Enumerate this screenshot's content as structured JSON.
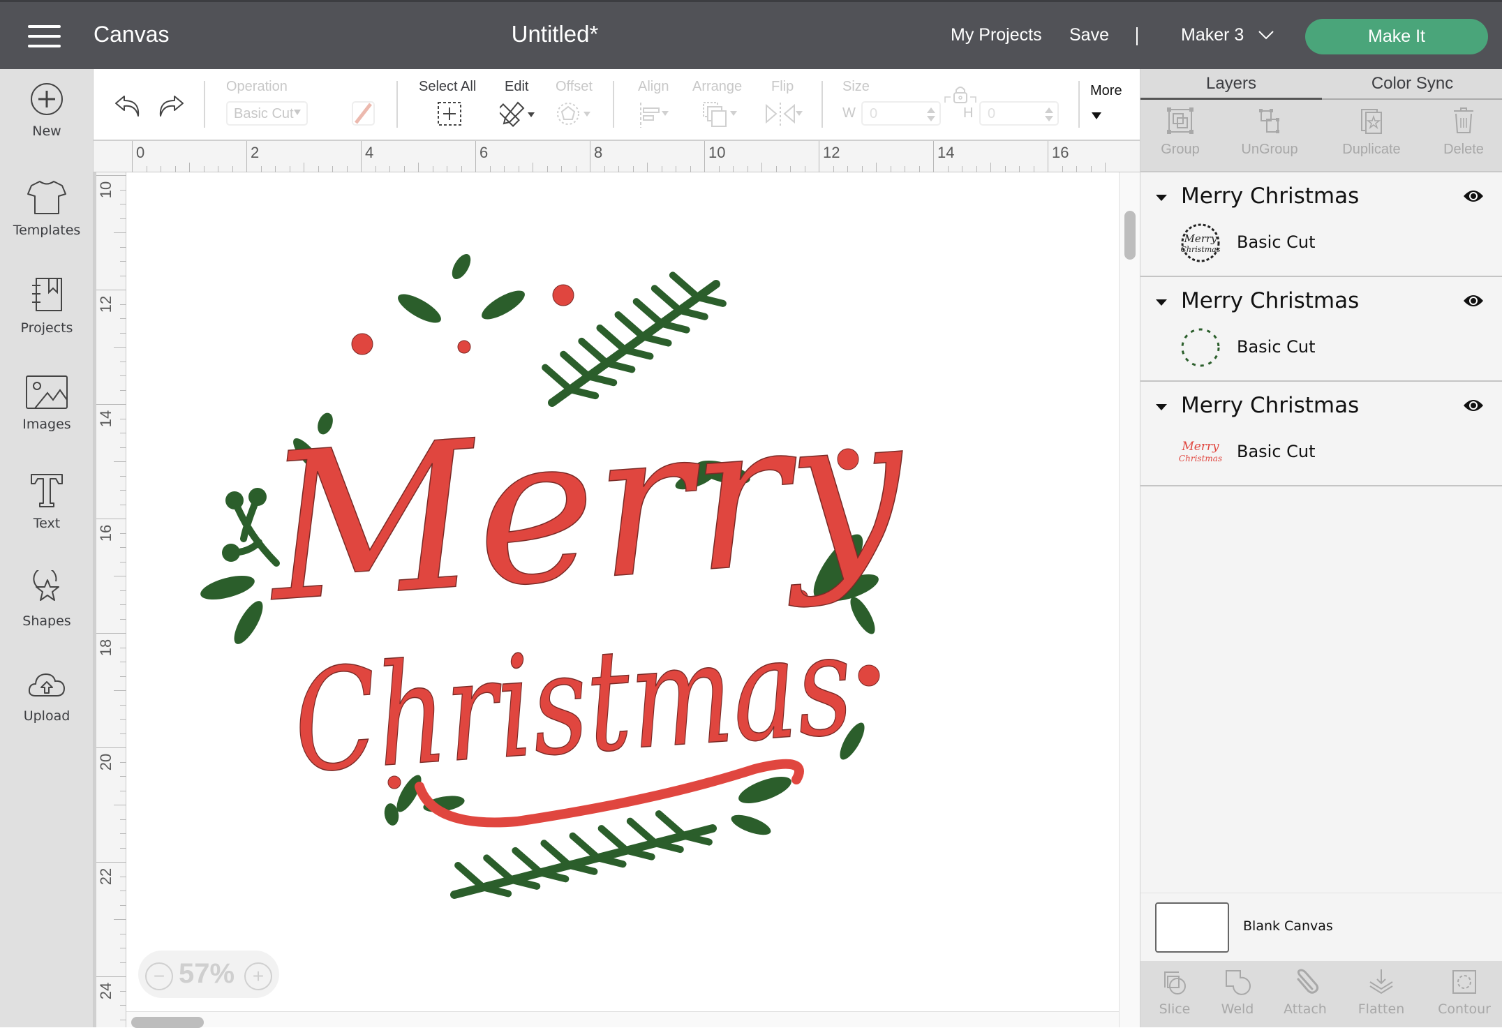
{
  "header": {
    "menu_icon": "hamburger-menu-icon",
    "app_title": "Canvas",
    "document_title": "Untitled*",
    "my_projects_label": "My Projects",
    "save_label": "Save",
    "separator": "|",
    "machine": "Maker 3",
    "make_it_label": "Make It",
    "accent_color": "#4aa57a"
  },
  "sidebar": {
    "items": [
      {
        "label": "New",
        "icon": "plus-circle-icon"
      },
      {
        "label": "Templates",
        "icon": "tshirt-icon"
      },
      {
        "label": "Projects",
        "icon": "notebook-icon"
      },
      {
        "label": "Images",
        "icon": "image-icon"
      },
      {
        "label": "Text",
        "icon": "text-icon"
      },
      {
        "label": "Shapes",
        "icon": "shapes-icon"
      },
      {
        "label": "Upload",
        "icon": "cloud-upload-icon"
      }
    ]
  },
  "toolbar": {
    "undo_icon": "undo-icon",
    "redo_icon": "redo-icon",
    "operation_label": "Operation",
    "operation_value": "Basic Cut",
    "select_all_label": "Select All",
    "edit_label": "Edit",
    "offset_label": "Offset",
    "align_label": "Align",
    "arrange_label": "Arrange",
    "flip_label": "Flip",
    "size_label": "Size",
    "width_label": "W",
    "width_value": "0",
    "height_label": "H",
    "height_value": "0",
    "more_label": "More"
  },
  "rulers": {
    "horizontal": [
      "0",
      "2",
      "4",
      "6",
      "8",
      "10",
      "12",
      "14",
      "16"
    ],
    "vertical": [
      "10",
      "12",
      "14",
      "16",
      "18",
      "20",
      "22",
      "24"
    ]
  },
  "canvas": {
    "design_text_line1": "Merry",
    "design_text_line2": "Christmas",
    "text_color": "#e0463f",
    "foliage_color": "#2b5e2b",
    "zoom_level": "57%",
    "zoom_out_label": "−",
    "zoom_in_label": "+"
  },
  "right_panel": {
    "tabs": [
      {
        "label": "Layers",
        "active": true
      },
      {
        "label": "Color Sync",
        "active": false
      }
    ],
    "actions": [
      "Group",
      "UnGroup",
      "Duplicate",
      "Delete"
    ],
    "layers": [
      {
        "name": "Merry Christmas",
        "operation": "Basic Cut",
        "thumb_color": "#222222"
      },
      {
        "name": "Merry Christmas",
        "operation": "Basic Cut",
        "thumb_color": "#2b5e2b"
      },
      {
        "name": "Merry Christmas",
        "operation": "Basic Cut",
        "thumb_color": "#e0463f"
      }
    ],
    "blank_canvas_label": "Blank Canvas",
    "tools": [
      "Slice",
      "Weld",
      "Attach",
      "Flatten",
      "Contour"
    ]
  }
}
